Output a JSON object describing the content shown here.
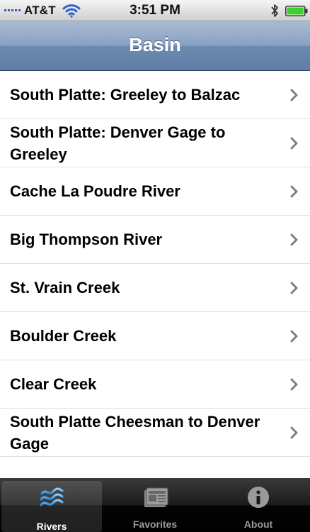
{
  "status_bar": {
    "carrier": "AT&T",
    "time": "3:51 PM",
    "icons": [
      "signal-icon",
      "wifi-icon",
      "bluetooth-icon",
      "battery-icon"
    ]
  },
  "nav": {
    "title": "Basin"
  },
  "rivers": [
    {
      "label": "South Platte: Greeley to Balzac"
    },
    {
      "label": "South Platte: Denver Gage to Greeley"
    },
    {
      "label": "Cache La Poudre River"
    },
    {
      "label": "Big Thompson River"
    },
    {
      "label": "St. Vrain Creek"
    },
    {
      "label": "Boulder Creek"
    },
    {
      "label": "Clear Creek"
    },
    {
      "label": "South Platte Cheesman to Denver Gage"
    }
  ],
  "tabs": [
    {
      "label": "Rivers",
      "icon": "waves-icon",
      "selected": true
    },
    {
      "label": "Favorites",
      "icon": "news-icon",
      "selected": false
    },
    {
      "label": "About",
      "icon": "info-icon",
      "selected": false
    }
  ],
  "colors": {
    "nav_bar": "#7090b6",
    "tab_bar": "#111111",
    "selected_tab_icon": "#4aa8f0",
    "unselected_tab": "#9a9a9a",
    "chevron": "#7f7f7f",
    "battery_fill": "#3fcf2f"
  }
}
